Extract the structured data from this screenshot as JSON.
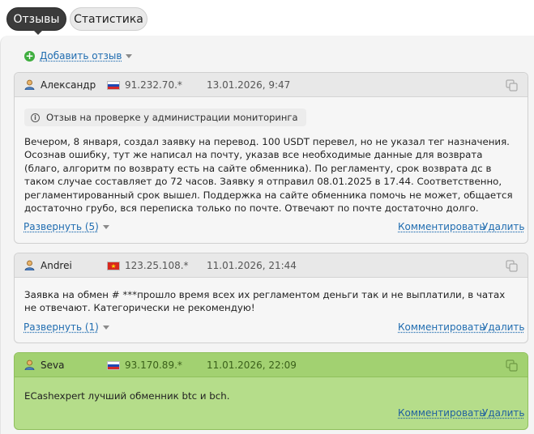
{
  "tabs": {
    "reviews": "Отзывы",
    "stats": "Статистика"
  },
  "add_review": {
    "label": "Добавить отзыв",
    "icon": "plus-circle-icon"
  },
  "actions": {
    "comment": "Комментировать",
    "delete": "Удалить"
  },
  "colors": {
    "positive_background": "#b5dd8a",
    "link": "#1f6cb0",
    "active_tab": "#3b3b3b"
  },
  "reviews": [
    {
      "author": "Александр",
      "flag": "Russia",
      "ip": "91.232.70.*",
      "date": "13.01.2026, 9:47",
      "notice": "Отзыв на проверке у администрации мониторинга",
      "text": "Вечером, 8 января, создал заявку на перевод. 100 USDT перевел, но не указал тег назначения. Осознав ошибку, тут же написал на почту, указав все необходимые данные для возврата (благо, алгоритм по возврату есть на сайте обменника). По регламенту, срок возврата дс в таком случае составляет до 72 часов. Заявку я отправил 08.01.2025 в 17.44. Соответственно, регламентированный срок вышел. Поддержка на сайте обменника помочь не может, общается достаточно грубо, вся переписка только по почте. Отвечают по почте достаточно долго.",
      "expand": "Развернуть (5)"
    },
    {
      "author": "Andrei",
      "flag": "Vietnam",
      "ip": "123.25.108.*",
      "date": "11.01.2026, 21:44",
      "text": "Заявка на обмен # ***прошло время всех их регламентом деньги так и не выплатили, в чатах не отвечают. Категорически не рекомендую!",
      "expand": "Развернуть (1)"
    },
    {
      "author": "Seva",
      "flag": "Russia",
      "ip": "93.170.89.*",
      "date": "11.01.2026, 22:09",
      "text": "ECashexpert лучший обменник btc и bch.",
      "sentiment": "positive"
    }
  ]
}
